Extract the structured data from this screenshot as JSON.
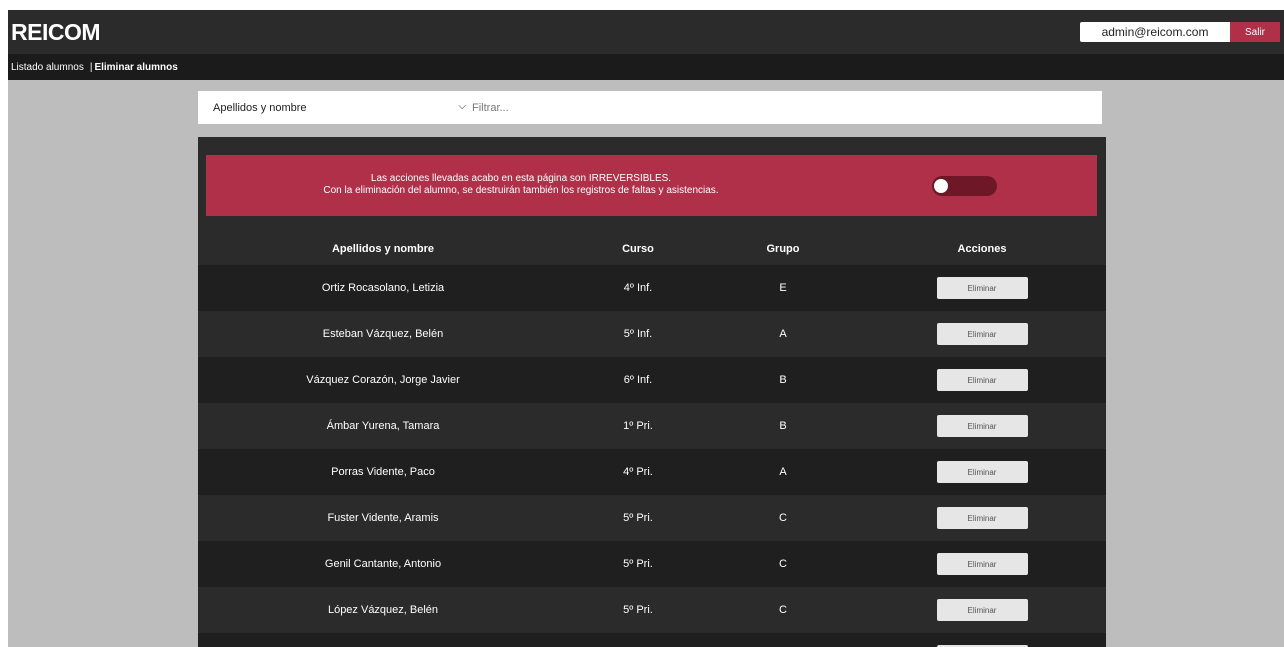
{
  "app": {
    "brand": "REICOM"
  },
  "header": {
    "user_email": "admin@reicom.com",
    "logout_label": "Salir"
  },
  "nav": {
    "link_list": "Listado alumnos",
    "separator": "|",
    "link_delete": "Eliminar alumnos"
  },
  "filter": {
    "select_value": "Apellidos y nombre",
    "placeholder": "Filtrar..."
  },
  "warning": {
    "line1": "Las acciones llevadas acabo en esta página son IRREVERSIBLES.",
    "line2": "Con la eliminación del alumno, se destruirán también los registros de faltas y asistencias.",
    "toggle_on": false
  },
  "table": {
    "headers": {
      "name": "Apellidos y nombre",
      "curso": "Curso",
      "grupo": "Grupo",
      "acciones": "Acciones"
    },
    "action_label": "Eliminar",
    "rows": [
      {
        "name": "Ortiz Rocasolano, Letizia",
        "curso": "4º Inf.",
        "grupo": "E"
      },
      {
        "name": "Esteban Vázquez, Belén",
        "curso": "5º Inf.",
        "grupo": "A"
      },
      {
        "name": "Vázquez Corazón, Jorge Javier",
        "curso": "6º Inf.",
        "grupo": "B"
      },
      {
        "name": "Ámbar Yurena, Tamara",
        "curso": "1º Pri.",
        "grupo": "B"
      },
      {
        "name": "Porras Vidente, Paco",
        "curso": "4º Pri.",
        "grupo": "A"
      },
      {
        "name": "Fuster Vidente, Aramis",
        "curso": "5º Pri.",
        "grupo": "C"
      },
      {
        "name": "Genil Cantante, Antonio",
        "curso": "5º Pri.",
        "grupo": "C"
      },
      {
        "name": "López Vázquez, Belén",
        "curso": "5º Pri.",
        "grupo": "C"
      },
      {
        "name": "",
        "curso": "",
        "grupo": ""
      }
    ]
  }
}
